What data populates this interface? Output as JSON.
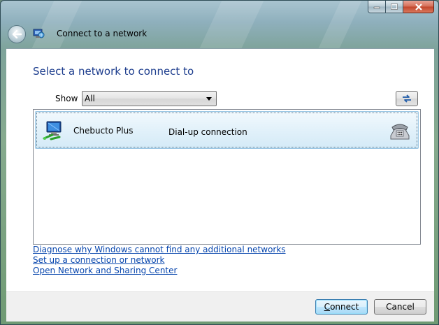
{
  "window": {
    "title": "Connect to a network"
  },
  "content": {
    "heading": "Select a network to connect to",
    "show_label": "Show",
    "show_value": "All"
  },
  "networks": [
    {
      "name": "Chebucto Plus",
      "type": "Dial-up connection",
      "icon": "network-computer-icon",
      "type_icon": "telephone-icon"
    }
  ],
  "links": {
    "diagnose": "Diagnose why Windows cannot find any additional networks",
    "setup": "Set up a connection or network",
    "open_center": "Open Network and Sharing Center"
  },
  "buttons": {
    "connect_rest": "onnect",
    "connect_accel": "C",
    "cancel": "Cancel"
  },
  "colors": {
    "heading": "#1e3e8e",
    "link": "#0645ad",
    "selection": "#d4eaf7"
  }
}
